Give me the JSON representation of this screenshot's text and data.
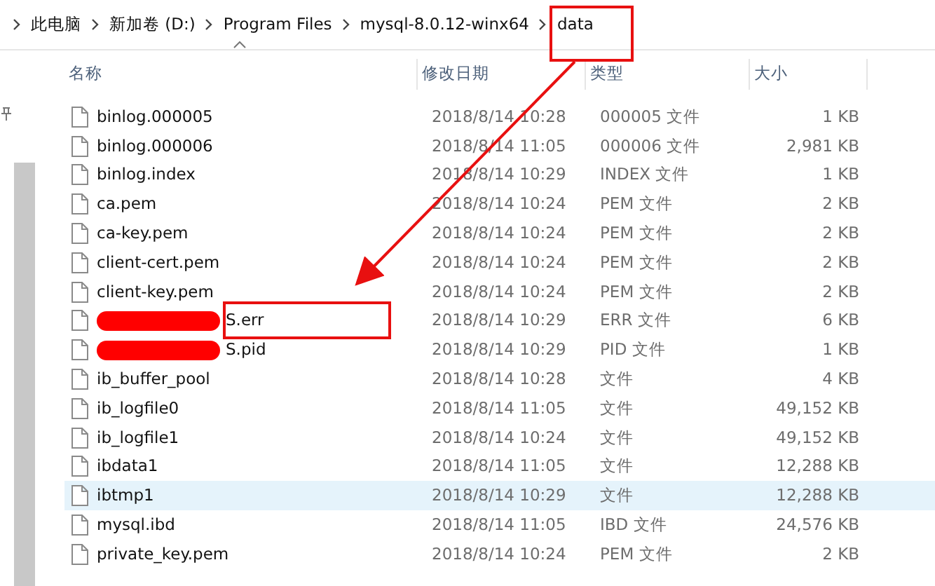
{
  "breadcrumb": [
    "此电脑",
    "新加卷 (D:)",
    "Program Files",
    "mysql-8.0.12-winx64",
    "data"
  ],
  "columns": [
    {
      "label": "名称",
      "sorted": true
    },
    {
      "label": "修改日期",
      "sorted": false
    },
    {
      "label": "类型",
      "sorted": false
    },
    {
      "label": "大小",
      "sorted": false
    }
  ],
  "rows": [
    {
      "name": "binlog.000005",
      "date": "2018/8/14 10:28",
      "type": "000005 文件",
      "size": "1 KB",
      "selected": false
    },
    {
      "name": "binlog.000006",
      "date": "2018/8/14 11:05",
      "type": "000006 文件",
      "size": "2,981 KB",
      "selected": false
    },
    {
      "name": "binlog.index",
      "date": "2018/8/14 10:29",
      "type": "INDEX 文件",
      "size": "1 KB",
      "selected": false
    },
    {
      "name": "ca.pem",
      "date": "2018/8/14 10:24",
      "type": "PEM 文件",
      "size": "2 KB",
      "selected": false
    },
    {
      "name": "ca-key.pem",
      "date": "2018/8/14 10:24",
      "type": "PEM 文件",
      "size": "2 KB",
      "selected": false
    },
    {
      "name": "client-cert.pem",
      "date": "2018/8/14 10:24",
      "type": "PEM 文件",
      "size": "2 KB",
      "selected": false
    },
    {
      "name": "client-key.pem",
      "date": "2018/8/14 10:24",
      "type": "PEM 文件",
      "size": "2 KB",
      "selected": false
    },
    {
      "name": "S.err",
      "redacted": true,
      "date": "2018/8/14 10:29",
      "type": "ERR 文件",
      "size": "6 KB",
      "selected": false
    },
    {
      "name": "S.pid",
      "redacted": true,
      "date": "2018/8/14 10:29",
      "type": "PID 文件",
      "size": "1 KB",
      "selected": false
    },
    {
      "name": "ib_buffer_pool",
      "date": "2018/8/14 10:28",
      "type": "文件",
      "size": "4 KB",
      "selected": false
    },
    {
      "name": "ib_logfile0",
      "date": "2018/8/14 11:05",
      "type": "文件",
      "size": "49,152 KB",
      "selected": false
    },
    {
      "name": "ib_logfile1",
      "date": "2018/8/14 10:24",
      "type": "文件",
      "size": "49,152 KB",
      "selected": false
    },
    {
      "name": "ibdata1",
      "date": "2018/8/14 11:05",
      "type": "文件",
      "size": "12,288 KB",
      "selected": false
    },
    {
      "name": "ibtmp1",
      "date": "2018/8/14 10:29",
      "type": "文件",
      "size": "12,288 KB",
      "selected": true
    },
    {
      "name": "mysql.ibd",
      "date": "2018/8/14 11:05",
      "type": "IBD 文件",
      "size": "24,576 KB",
      "selected": false
    },
    {
      "name": "private_key.pem",
      "date": "2018/8/14 10:24",
      "type": "PEM 文件",
      "size": "2 KB",
      "selected": false
    }
  ]
}
